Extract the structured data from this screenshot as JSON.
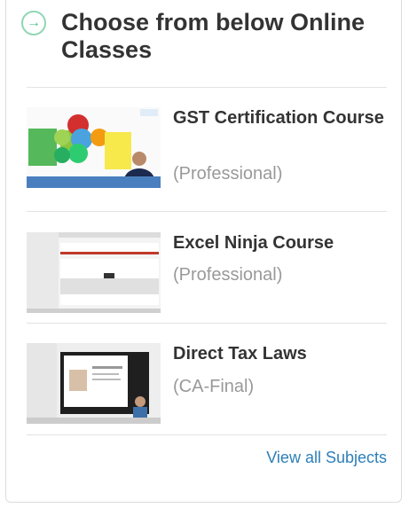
{
  "header": {
    "title": "Choose from below Online Classes",
    "icon": "circle-arrow-right-icon"
  },
  "courses": [
    {
      "title": "GST Certification Course",
      "category": "(Professional)"
    },
    {
      "title": "Excel Ninja Course",
      "category": "(Professional)"
    },
    {
      "title": "Direct Tax Laws",
      "category": "(CA-Final)"
    }
  ],
  "footer": {
    "view_all_label": "View all Subjects"
  },
  "colors": {
    "title": "#333333",
    "category": "#999999",
    "link": "#2d7fb8",
    "icon": "#58c08c",
    "divider": "#e3e3e3"
  }
}
